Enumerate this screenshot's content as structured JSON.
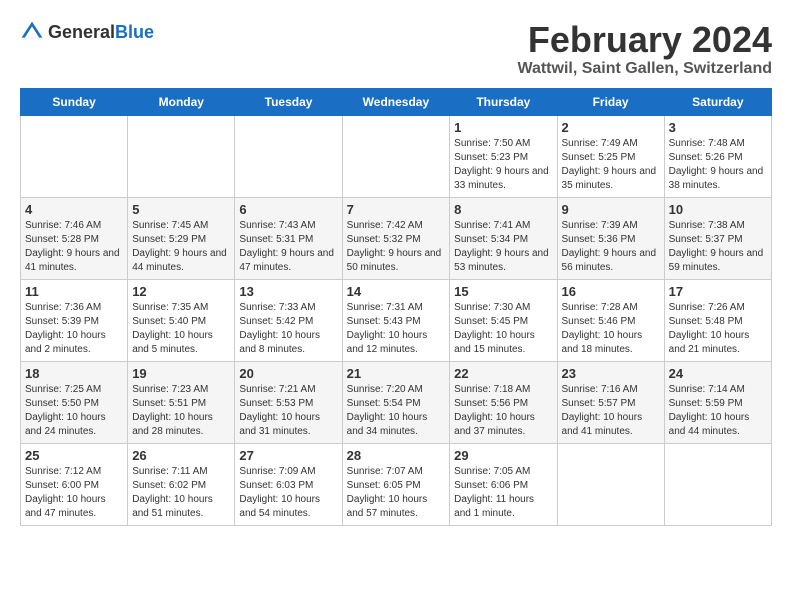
{
  "logo": {
    "general": "General",
    "blue": "Blue"
  },
  "title": "February 2024",
  "subtitle": "Wattwil, Saint Gallen, Switzerland",
  "days": [
    "Sunday",
    "Monday",
    "Tuesday",
    "Wednesday",
    "Thursday",
    "Friday",
    "Saturday"
  ],
  "weeks": [
    [
      {
        "day": "",
        "detail": ""
      },
      {
        "day": "",
        "detail": ""
      },
      {
        "day": "",
        "detail": ""
      },
      {
        "day": "",
        "detail": ""
      },
      {
        "day": "1",
        "detail": "Sunrise: 7:50 AM\nSunset: 5:23 PM\nDaylight: 9 hours and 33 minutes."
      },
      {
        "day": "2",
        "detail": "Sunrise: 7:49 AM\nSunset: 5:25 PM\nDaylight: 9 hours and 35 minutes."
      },
      {
        "day": "3",
        "detail": "Sunrise: 7:48 AM\nSunset: 5:26 PM\nDaylight: 9 hours and 38 minutes."
      }
    ],
    [
      {
        "day": "4",
        "detail": "Sunrise: 7:46 AM\nSunset: 5:28 PM\nDaylight: 9 hours and 41 minutes."
      },
      {
        "day": "5",
        "detail": "Sunrise: 7:45 AM\nSunset: 5:29 PM\nDaylight: 9 hours and 44 minutes."
      },
      {
        "day": "6",
        "detail": "Sunrise: 7:43 AM\nSunset: 5:31 PM\nDaylight: 9 hours and 47 minutes."
      },
      {
        "day": "7",
        "detail": "Sunrise: 7:42 AM\nSunset: 5:32 PM\nDaylight: 9 hours and 50 minutes."
      },
      {
        "day": "8",
        "detail": "Sunrise: 7:41 AM\nSunset: 5:34 PM\nDaylight: 9 hours and 53 minutes."
      },
      {
        "day": "9",
        "detail": "Sunrise: 7:39 AM\nSunset: 5:36 PM\nDaylight: 9 hours and 56 minutes."
      },
      {
        "day": "10",
        "detail": "Sunrise: 7:38 AM\nSunset: 5:37 PM\nDaylight: 9 hours and 59 minutes."
      }
    ],
    [
      {
        "day": "11",
        "detail": "Sunrise: 7:36 AM\nSunset: 5:39 PM\nDaylight: 10 hours and 2 minutes."
      },
      {
        "day": "12",
        "detail": "Sunrise: 7:35 AM\nSunset: 5:40 PM\nDaylight: 10 hours and 5 minutes."
      },
      {
        "day": "13",
        "detail": "Sunrise: 7:33 AM\nSunset: 5:42 PM\nDaylight: 10 hours and 8 minutes."
      },
      {
        "day": "14",
        "detail": "Sunrise: 7:31 AM\nSunset: 5:43 PM\nDaylight: 10 hours and 12 minutes."
      },
      {
        "day": "15",
        "detail": "Sunrise: 7:30 AM\nSunset: 5:45 PM\nDaylight: 10 hours and 15 minutes."
      },
      {
        "day": "16",
        "detail": "Sunrise: 7:28 AM\nSunset: 5:46 PM\nDaylight: 10 hours and 18 minutes."
      },
      {
        "day": "17",
        "detail": "Sunrise: 7:26 AM\nSunset: 5:48 PM\nDaylight: 10 hours and 21 minutes."
      }
    ],
    [
      {
        "day": "18",
        "detail": "Sunrise: 7:25 AM\nSunset: 5:50 PM\nDaylight: 10 hours and 24 minutes."
      },
      {
        "day": "19",
        "detail": "Sunrise: 7:23 AM\nSunset: 5:51 PM\nDaylight: 10 hours and 28 minutes."
      },
      {
        "day": "20",
        "detail": "Sunrise: 7:21 AM\nSunset: 5:53 PM\nDaylight: 10 hours and 31 minutes."
      },
      {
        "day": "21",
        "detail": "Sunrise: 7:20 AM\nSunset: 5:54 PM\nDaylight: 10 hours and 34 minutes."
      },
      {
        "day": "22",
        "detail": "Sunrise: 7:18 AM\nSunset: 5:56 PM\nDaylight: 10 hours and 37 minutes."
      },
      {
        "day": "23",
        "detail": "Sunrise: 7:16 AM\nSunset: 5:57 PM\nDaylight: 10 hours and 41 minutes."
      },
      {
        "day": "24",
        "detail": "Sunrise: 7:14 AM\nSunset: 5:59 PM\nDaylight: 10 hours and 44 minutes."
      }
    ],
    [
      {
        "day": "25",
        "detail": "Sunrise: 7:12 AM\nSunset: 6:00 PM\nDaylight: 10 hours and 47 minutes."
      },
      {
        "day": "26",
        "detail": "Sunrise: 7:11 AM\nSunset: 6:02 PM\nDaylight: 10 hours and 51 minutes."
      },
      {
        "day": "27",
        "detail": "Sunrise: 7:09 AM\nSunset: 6:03 PM\nDaylight: 10 hours and 54 minutes."
      },
      {
        "day": "28",
        "detail": "Sunrise: 7:07 AM\nSunset: 6:05 PM\nDaylight: 10 hours and 57 minutes."
      },
      {
        "day": "29",
        "detail": "Sunrise: 7:05 AM\nSunset: 6:06 PM\nDaylight: 11 hours and 1 minute."
      },
      {
        "day": "",
        "detail": ""
      },
      {
        "day": "",
        "detail": ""
      }
    ]
  ]
}
